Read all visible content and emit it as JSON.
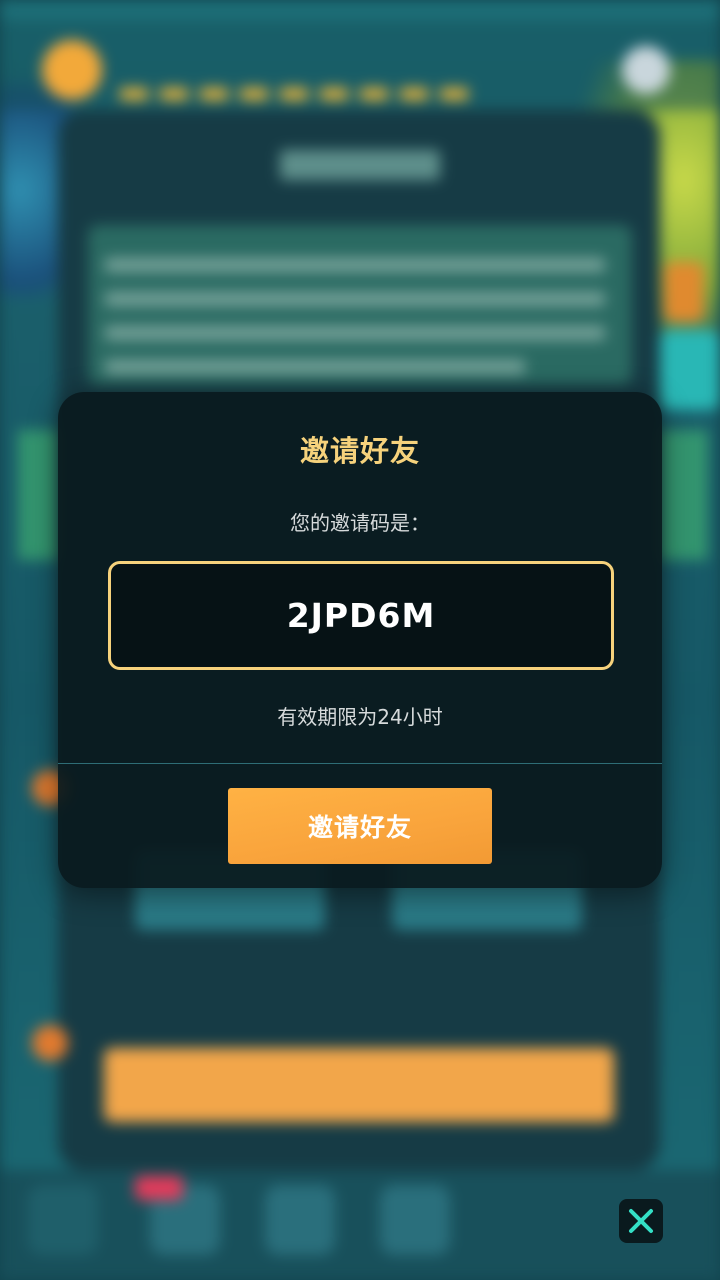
{
  "modal": {
    "title": "邀请好友",
    "code_label": "您的邀请码是：",
    "invite_code": "2JPD6M",
    "expiry_text": "有效期限为24小时",
    "invite_button_label": "邀请好友"
  },
  "controls": {
    "close_icon": "close-icon"
  },
  "colors": {
    "accent_gold": "#f6d27c",
    "button_orange": "#f9a43c",
    "modal_bg": "#0a1a1e",
    "close_x": "#34e0c6"
  }
}
